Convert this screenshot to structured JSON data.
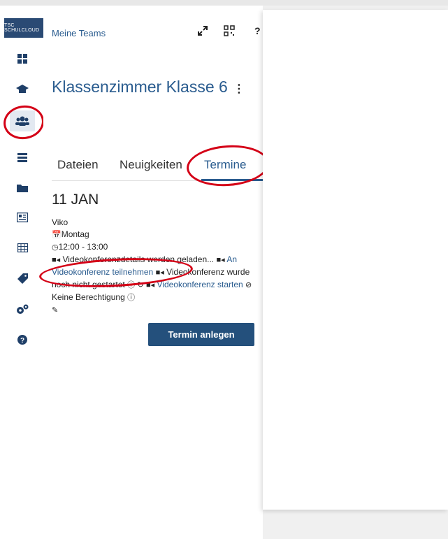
{
  "app": {
    "logo_text": "TSC SCHULCLOUD"
  },
  "sidebar": {
    "items": [
      {
        "icon": "dashboard-icon"
      },
      {
        "icon": "graduation-cap-icon"
      },
      {
        "icon": "users-icon",
        "active": true
      },
      {
        "icon": "tasks-icon"
      },
      {
        "icon": "folder-icon"
      },
      {
        "icon": "news-icon"
      },
      {
        "icon": "calendar-grid-icon"
      },
      {
        "icon": "tag-icon"
      },
      {
        "icon": "gears-icon"
      },
      {
        "icon": "question-icon"
      }
    ]
  },
  "header": {
    "breadcrumb": "Meine Teams",
    "tools": [
      "expand-icon",
      "qr-code-icon",
      "help-icon"
    ]
  },
  "team": {
    "title": "Klassenzimmer Klasse 6"
  },
  "tabs": [
    {
      "label": "Dateien"
    },
    {
      "label": "Neuigkeiten"
    },
    {
      "label": "Termine",
      "active": true
    }
  ],
  "event": {
    "date": "11 JAN",
    "name": "Viko",
    "weekday": "Montag",
    "time": "12:00 - 13:00",
    "loading_text": "Videokonferenzdetails werden geladen...",
    "join_link": "An Videokonferenz teilnehmen",
    "not_started_text": "Videokonferenz wurde noch nicht gestartet",
    "start_link": "Videokonferenz starten",
    "no_permission_text": "Keine Berechtigung"
  },
  "actions": {
    "create_event": "Termin anlegen"
  },
  "colors": {
    "brand": "#2a5c8f",
    "button": "#24507c",
    "annotation": "#d40016"
  }
}
